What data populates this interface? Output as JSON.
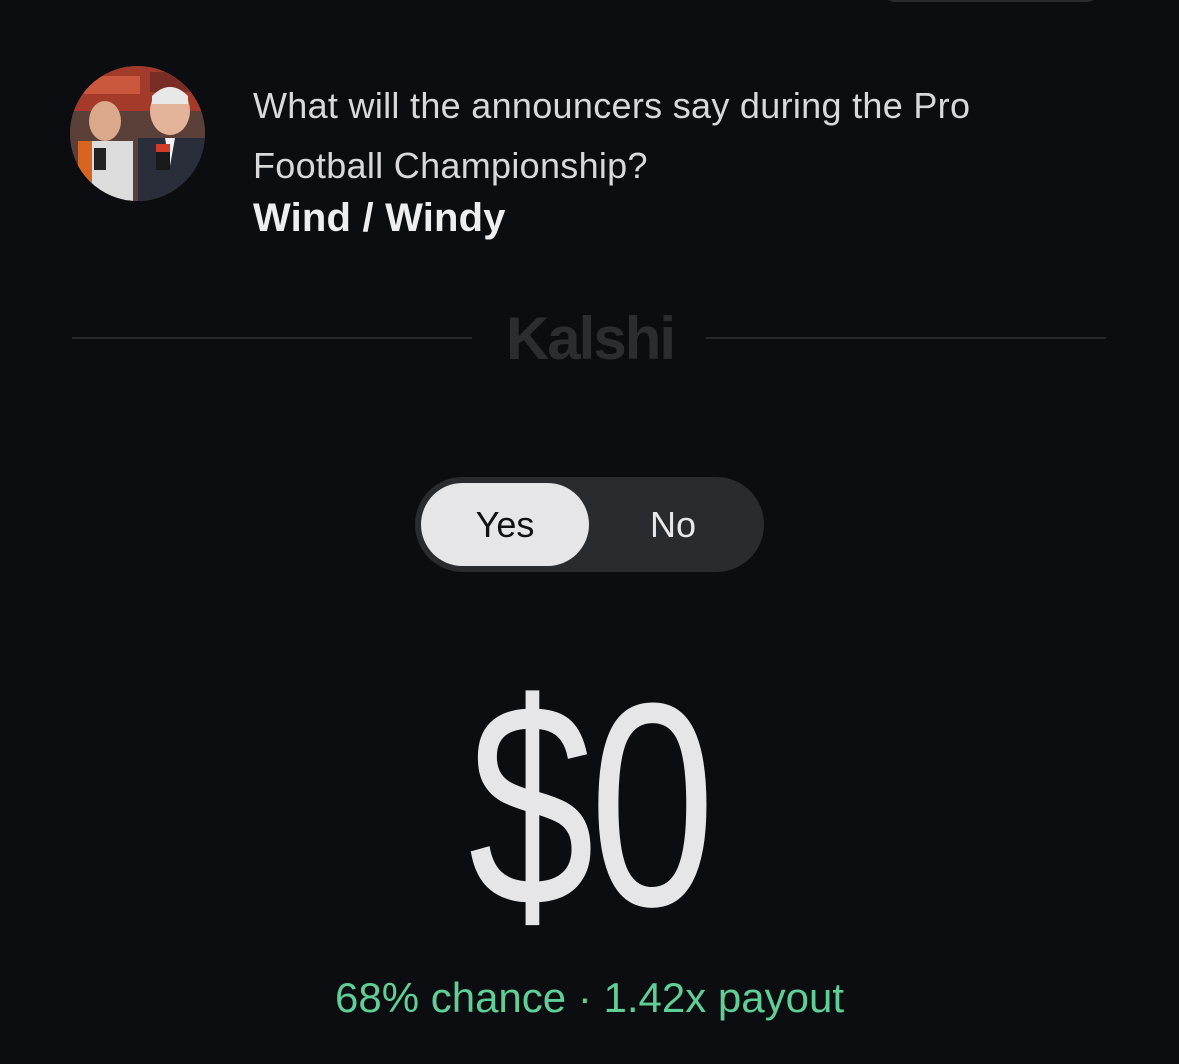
{
  "market": {
    "question": "What will the announcers say during the Pro Football Championship?",
    "outcome": "Wind / Windy"
  },
  "brand": {
    "name": "Kalshi"
  },
  "side_toggle": {
    "options": [
      "Yes",
      "No"
    ],
    "selected": "Yes"
  },
  "order": {
    "amount": "$0",
    "chance": "68% chance",
    "separator": "·",
    "payout": "1.42x payout"
  },
  "colors": {
    "background": "#0c0d10",
    "accent_green": "#5fcf97",
    "toggle_selected": "#e6e6e8",
    "toggle_track": "#2a2b2e"
  },
  "icons": {
    "avatar": "announcers-photo"
  }
}
